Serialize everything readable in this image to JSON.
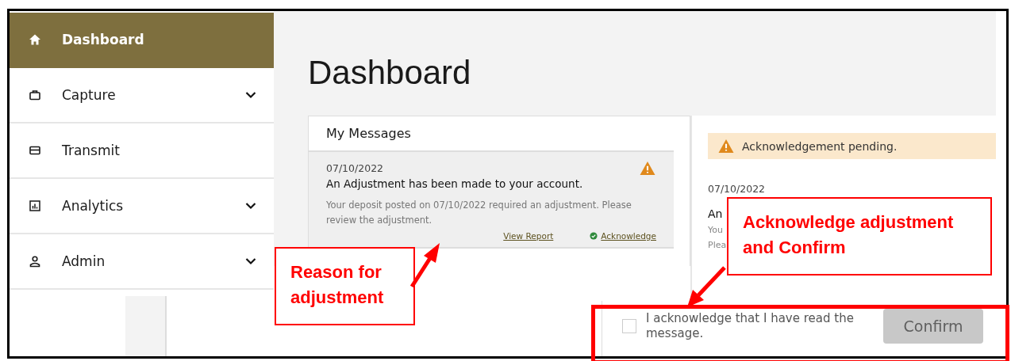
{
  "sidebar": {
    "items": [
      {
        "label": "Dashboard",
        "kind": "home",
        "selected": true,
        "expandable": false
      },
      {
        "label": "Capture",
        "kind": "briefcase",
        "selected": false,
        "expandable": true
      },
      {
        "label": "Transmit",
        "kind": "card",
        "selected": false,
        "expandable": false
      },
      {
        "label": "Analytics",
        "kind": "chart",
        "selected": false,
        "expandable": true
      },
      {
        "label": "Admin",
        "kind": "person",
        "selected": false,
        "expandable": true
      }
    ]
  },
  "page_title": "Dashboard",
  "messages": {
    "title": "My Messages",
    "items": [
      {
        "date": "07/10/2022",
        "title": "An Adjustment has been made to your account.",
        "body": "Your deposit posted on 07/10/2022 required an adjustment. Please review the adjustment.",
        "warning": true,
        "view_link": "View Report",
        "ack_link": "Acknowledge"
      }
    ]
  },
  "detail": {
    "alert": "Acknowledgement pending.",
    "date": "07/10/2022",
    "title": "An",
    "body_lines": [
      "You",
      "Plea"
    ]
  },
  "acknowledge": {
    "checked": false,
    "label": "I acknowledge that I have read the message.",
    "button": "Confirm",
    "button_disabled": true
  },
  "annotations": [
    {
      "text": "Reason for adjustment"
    },
    {
      "text": "Acknowledge adjustment and Confirm"
    }
  ]
}
